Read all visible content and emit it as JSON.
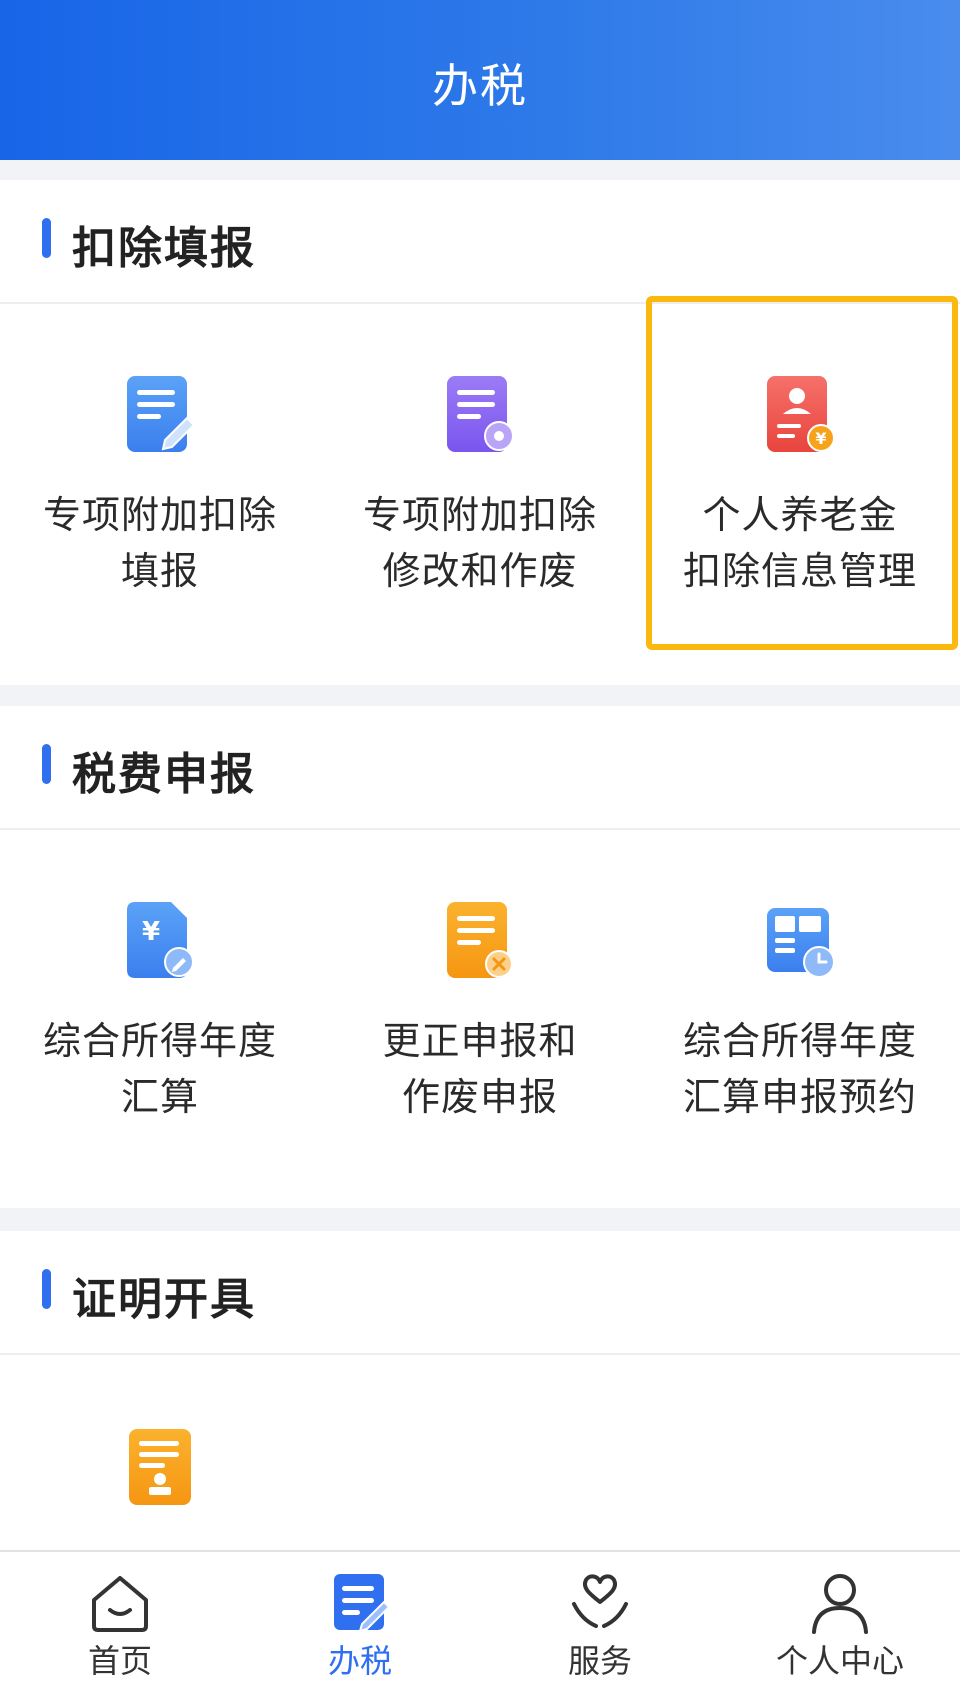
{
  "header": {
    "title": "办税"
  },
  "sections": [
    {
      "title": "扣除填报",
      "items": [
        {
          "lines": [
            "专项附加扣除",
            "填报"
          ],
          "icon": "document-edit-icon",
          "color": "#4a90f5"
        },
        {
          "lines": [
            "专项附加扣除",
            "修改和作废"
          ],
          "icon": "document-settings-icon",
          "color": "#8a63f0"
        },
        {
          "lines": [
            "个人养老金",
            "扣除信息管理"
          ],
          "icon": "pension-card-icon",
          "color": "#f0524a",
          "highlighted": true
        }
      ]
    },
    {
      "title": "税费申报",
      "items": [
        {
          "lines": [
            "综合所得年度",
            "汇算"
          ],
          "icon": "yuan-document-edit-icon",
          "color": "#4a90f5"
        },
        {
          "lines": [
            "更正申报和",
            "作废申报"
          ],
          "icon": "document-cancel-icon",
          "color": "#f7a21b"
        },
        {
          "lines": [
            "综合所得年度",
            "汇算申报预约"
          ],
          "icon": "calendar-clock-icon",
          "color": "#4a90f5"
        }
      ]
    },
    {
      "title": "证明开具",
      "items": [
        {
          "lines": [],
          "icon": "certificate-stamp-icon",
          "color": "#f7a21b"
        }
      ]
    }
  ],
  "tabbar": {
    "tabs": [
      {
        "label": "首页",
        "icon": "home-icon",
        "active": false
      },
      {
        "label": "办税",
        "icon": "tax-document-icon",
        "active": true
      },
      {
        "label": "服务",
        "icon": "heart-hands-icon",
        "active": false
      },
      {
        "label": "个人中心",
        "icon": "person-icon",
        "active": false
      }
    ]
  },
  "colors": {
    "accent": "#2f6ff0",
    "highlight_border": "#fbb80f",
    "header_start": "#1865e8",
    "header_end": "#4a8cee"
  }
}
